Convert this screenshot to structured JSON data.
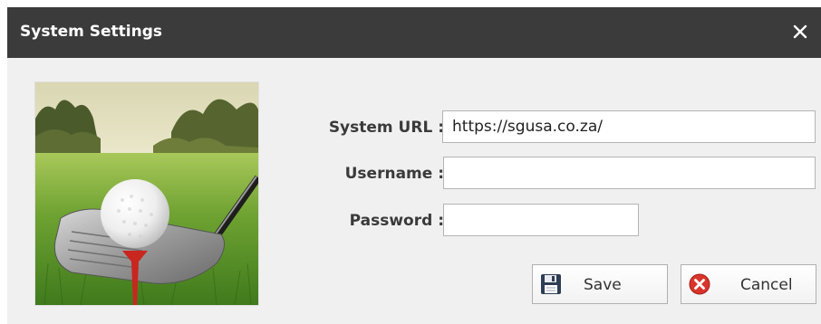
{
  "window": {
    "title": "System Settings",
    "close_icon": "close-icon"
  },
  "image": {
    "subject": "golf-ball-on-tee-with-club"
  },
  "form": {
    "system_url_label": "System URL :",
    "system_url_value": "https://sgusa.co.za/",
    "username_label": "Username :",
    "username_value": "",
    "password_label": "Password :",
    "password_value": ""
  },
  "buttons": {
    "save_label": "Save",
    "save_icon": "floppy-disk-icon",
    "cancel_label": "Cancel",
    "cancel_icon": "cancel-x-icon"
  },
  "colors": {
    "titlebar": "#3b3b3b",
    "dialog_background": "#f0f0f0",
    "cancel_icon_red": "#d9342b"
  }
}
